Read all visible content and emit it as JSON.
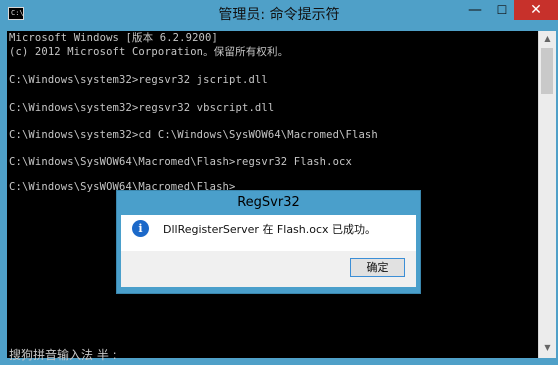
{
  "window": {
    "title": "管理员: 命令提示符",
    "app_icon_text": "C:\\",
    "controls": {
      "minimize": "—",
      "maximize": "☐",
      "close": "✕"
    }
  },
  "console": {
    "lines": [
      "Microsoft Windows [版本 6.2.9200]",
      "(c) 2012 Microsoft Corporation。保留所有权利。",
      "",
      "C:\\Windows\\system32>regsvr32 jscript.dll",
      "",
      "C:\\Windows\\system32>regsvr32 vbscript.dll",
      "",
      "C:\\Windows\\system32>cd C:\\Windows\\SysWOW64\\Macromed\\Flash",
      "",
      "C:\\Windows\\SysWOW64\\Macromed\\Flash>regsvr32 Flash.ocx",
      "",
      "C:\\Windows\\SysWOW64\\Macromed\\Flash>"
    ],
    "ime_status": "搜狗拼音输入法 半 :"
  },
  "dialog": {
    "title": "RegSvr32",
    "message": "DllRegisterServer 在 Flash.ocx 已成功。",
    "ok_label": "确定",
    "icon": "info-icon"
  },
  "colors": {
    "frame": "#4fa0c8",
    "console_bg": "#000000",
    "console_text": "#c6c6c6",
    "close_button": "#c7312b"
  }
}
